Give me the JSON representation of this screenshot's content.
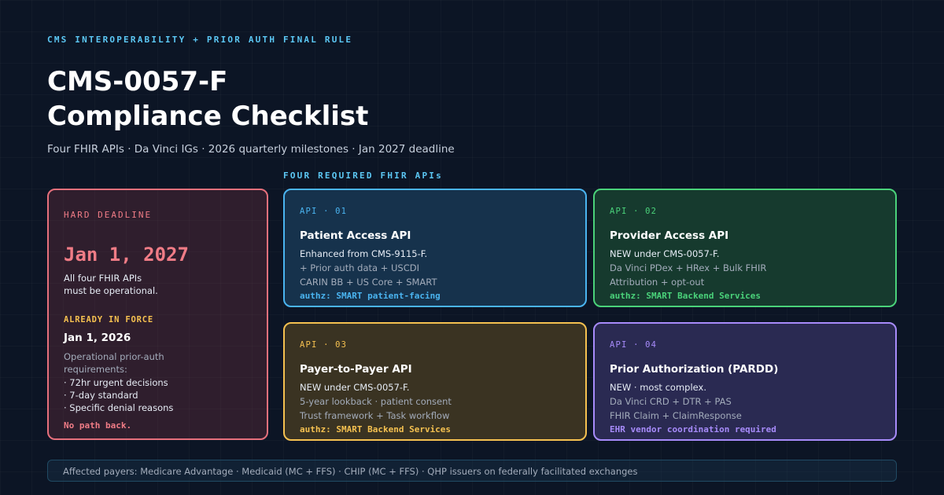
{
  "header": {
    "eyebrow": "CMS INTEROPERABILITY + PRIOR AUTH FINAL RULE",
    "title_line1": "CMS-0057-F",
    "title_line2": "Compliance Checklist",
    "subtitle": "Four FHIR APIs · Da Vinci IGs · 2026 quarterly milestones · Jan 2027 deadline",
    "section_label": "FOUR REQUIRED FHIR APIs"
  },
  "deadline": {
    "label": "HARD DEADLINE",
    "date": "Jan 1, 2027",
    "desc_line1": "All four FHIR APIs",
    "desc_line2": "must be operational.",
    "in_force_label": "ALREADY IN FORCE",
    "in_force_date": "Jan 1, 2026",
    "in_force_line1": "Operational prior-auth",
    "in_force_line2": "requirements:",
    "items": [
      "· 72hr urgent decisions",
      "· 7-day standard",
      "· Specific denial reasons"
    ],
    "footer": "No path back.",
    "color": "#f07c86"
  },
  "apis": [
    {
      "tag": "API · 01",
      "name": "Patient Access API",
      "lead": "Enhanced from CMS-9115-F.",
      "detail1": "+ Prior auth data + USCDI",
      "detail2": "CARIN BB + US Core + SMART",
      "authz": "authz: SMART patient-facing",
      "accent": "#4ab4f0",
      "fill": "#16324c"
    },
    {
      "tag": "API · 02",
      "name": "Provider Access API",
      "lead": "NEW under CMS-0057-F.",
      "detail1": "Da Vinci PDex + HRex + Bulk FHIR",
      "detail2": "Attribution + opt-out",
      "authz": "authz: SMART Backend Services",
      "accent": "#4ad27a",
      "fill": "#163a2e"
    },
    {
      "tag": "API · 03",
      "name": "Payer-to-Payer API",
      "lead": "NEW under CMS-0057-F.",
      "detail1": "5-year lookback · patient consent",
      "detail2": "Trust framework + Task workflow",
      "authz": "authz: SMART Backend Services",
      "accent": "#f5c150",
      "fill": "#3a3322"
    },
    {
      "tag": "API · 04",
      "name": "Prior Authorization (PARDD)",
      "lead": "NEW · most complex.",
      "detail1": "Da Vinci CRD + DTR + PAS",
      "detail2": "FHIR Claim + ClaimResponse",
      "authz": "EHR vendor coordination required",
      "accent": "#a78bfa",
      "fill": "#2a2a52"
    }
  ],
  "footer": {
    "payers": "Affected payers: Medicare Advantage · Medicaid (MC + FFS) · CHIP (MC + FFS) · QHP issuers on federally facilitated exchanges"
  }
}
